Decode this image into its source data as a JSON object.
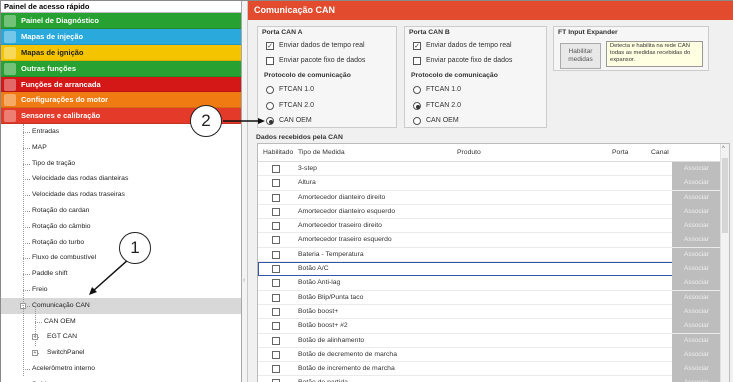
{
  "left_panel": {
    "title": "Painel de acesso rápido",
    "categories": [
      {
        "label": "Painel de Diagnóstico",
        "color": "#27a132",
        "icon": "diagnostic-icon"
      },
      {
        "label": "Mapas de injeção",
        "color": "#2aa9dd",
        "icon": "injection-icon"
      },
      {
        "label": "Mapas de ignição",
        "color": "#f5c400",
        "icon": "ignition-icon"
      },
      {
        "label": "Outras funções",
        "color": "#27a132",
        "icon": "functions-icon"
      },
      {
        "label": "Funções de arrancada",
        "color": "#d41818",
        "icon": "drag-icon"
      },
      {
        "label": "Configurações do motor",
        "color": "#f07b12",
        "icon": "engine-icon"
      },
      {
        "label": "Sensores e calibração",
        "color": "#e43a2a",
        "icon": "sensors-icon"
      }
    ],
    "tree": [
      "Entradas",
      "MAP",
      "Tipo de tração",
      "Velocidade das rodas dianteiras",
      "Velocidade das rodas traseiras",
      "Rotação do cardan",
      "Rotação do câmbio",
      "Rotação do turbo",
      "Fluxo de combustível",
      "Paddle shift",
      "Freio",
      "Comunicação CAN",
      "CAN OEM",
      "EGT CAN",
      "SwitchPanel",
      "Acelerômetro interno",
      "Saídas"
    ]
  },
  "panel": {
    "title": "Comunicação CAN",
    "can_a": {
      "title": "Porta CAN A",
      "opt1": "Enviar dados de tempo real",
      "opt2": "Enviar pacote fixo de dados",
      "proto": "Protocolo de comunicação",
      "r1": "FTCAN 1.0",
      "r2": "FTCAN 2.0",
      "r3": "CAN OEM"
    },
    "can_b": {
      "title": "Porta CAN B",
      "opt1": "Enviar dados de tempo real",
      "opt2": "Enviar pacote fixo de dados",
      "proto": "Protocolo de comunicação",
      "r1": "FTCAN 1.0",
      "r2": "FTCAN 2.0",
      "r3": "CAN OEM"
    },
    "expander": {
      "title": "FT Input Expander",
      "button": "Habilitar medidas",
      "tooltip": "Detecta e habilita na rede CAN todas as medidas recebidas do expansor."
    }
  },
  "table": {
    "title": "Dados recebidos pela CAN",
    "headers": [
      "Habilitado",
      "Tipo de Medida",
      "Produto",
      "Porta",
      "Canal"
    ],
    "button_label": "Associar",
    "rows": [
      "3-step",
      "Altura",
      "Amortecedor dianteiro direito",
      "Amortecedor dianteiro esquerdo",
      "Amortecedor traseiro direito",
      "Amortecedor traseiro esquerdo",
      "Bateria - Temperatura",
      "Botão A/C",
      "Botão Anti-lag",
      "Botão Blip/Punta taco",
      "Botão boost+",
      "Botão boost+ #2",
      "Botão de alinhamento",
      "Botão de decremento de marcha",
      "Botão de incremento de marcha",
      "Botão de partida"
    ]
  },
  "callouts": {
    "one": "1",
    "two": "2"
  }
}
